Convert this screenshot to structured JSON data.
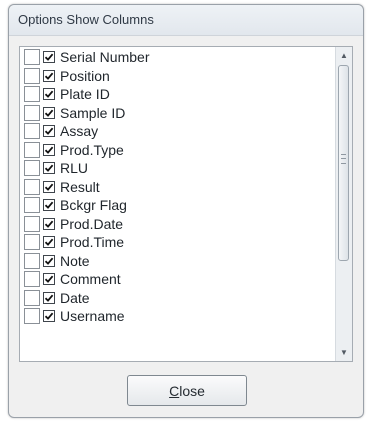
{
  "dialog": {
    "title": "Options Show Columns",
    "close_label_prefix": "C",
    "close_label_rest": "lose"
  },
  "columns": [
    {
      "label": "Serial Number",
      "checked": true
    },
    {
      "label": "Position",
      "checked": true
    },
    {
      "label": "Plate ID",
      "checked": true
    },
    {
      "label": "Sample ID",
      "checked": true
    },
    {
      "label": "Assay",
      "checked": true
    },
    {
      "label": "Prod.Type",
      "checked": true
    },
    {
      "label": "RLU",
      "checked": true
    },
    {
      "label": "Result",
      "checked": true
    },
    {
      "label": "Bckgr Flag",
      "checked": true
    },
    {
      "label": "Prod.Date",
      "checked": true
    },
    {
      "label": "Prod.Time",
      "checked": true
    },
    {
      "label": "Note",
      "checked": true
    },
    {
      "label": "Comment",
      "checked": true
    },
    {
      "label": "Date",
      "checked": true
    },
    {
      "label": "Username",
      "checked": true
    }
  ],
  "scrollbar": {
    "up_icon": "▲",
    "down_icon": "▼",
    "position": 0
  }
}
